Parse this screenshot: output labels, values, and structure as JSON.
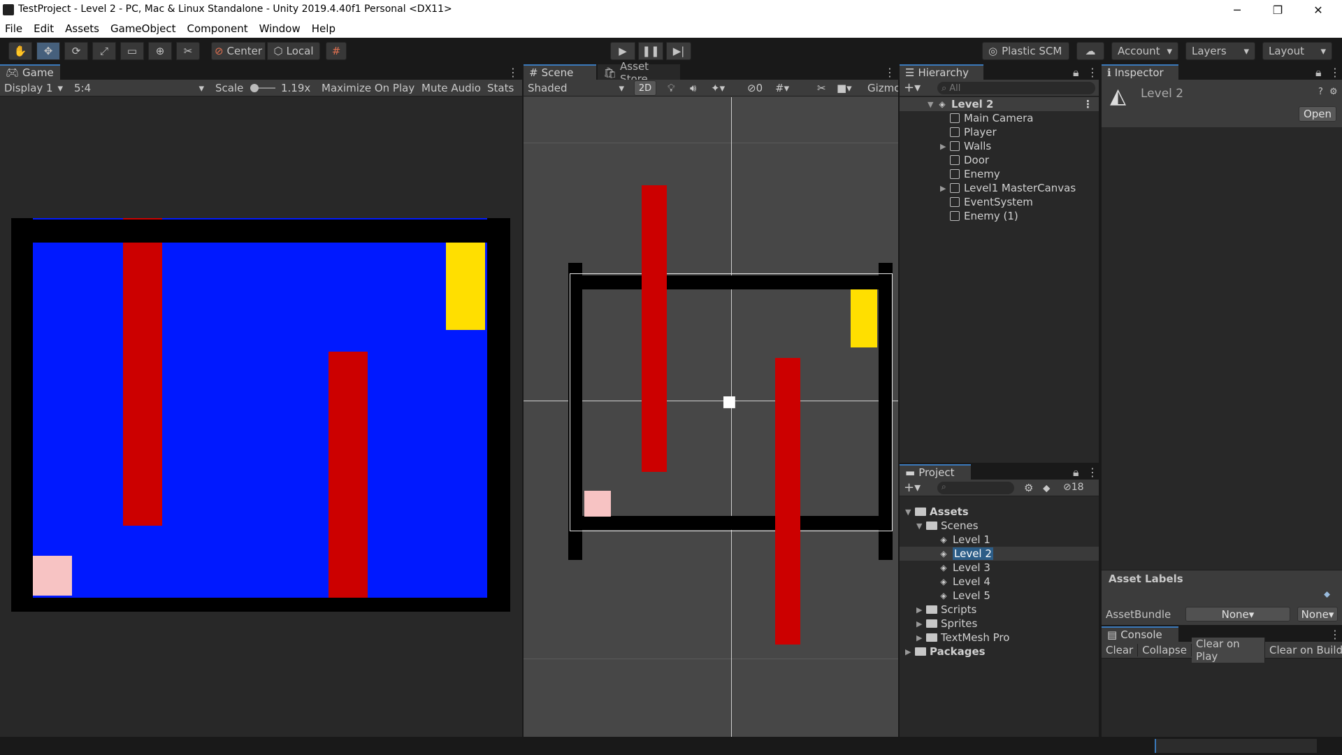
{
  "window": {
    "title": "TestProject - Level 2 - PC, Mac & Linux Standalone - Unity 2019.4.40f1 Personal <DX11>",
    "minimize_glyph": "─",
    "restore_glyph": "❐",
    "close_glyph": "✕"
  },
  "menu": [
    "File",
    "Edit",
    "Assets",
    "GameObject",
    "Component",
    "Window",
    "Help"
  ],
  "toolbar": {
    "pivot_label": "Center",
    "space_label": "Local",
    "plastic_label": "Plastic SCM",
    "account_label": "Account",
    "layers_label": "Layers",
    "layout_label": "Layout"
  },
  "game": {
    "tab_label": "Game",
    "display": "Display 1",
    "aspect": "5:4",
    "scale_label": "Scale",
    "scale_value": "1.19x",
    "maximize": "Maximize On Play",
    "mute": "Mute Audio",
    "stats": "Stats"
  },
  "scene": {
    "tab_label": "Scene",
    "asset_store_label": "Asset Store",
    "shading": "Shaded",
    "mode_2d": "2D",
    "hidden_count": "0",
    "gizmos": "Gizmos"
  },
  "hierarchy": {
    "tab_label": "Hierarchy",
    "search_placeholder": "All",
    "scene_name": "Level 2",
    "items": [
      "Main Camera",
      "Player",
      "Walls",
      "Door",
      "Enemy",
      "Level1 MasterCanvas",
      "EventSystem",
      "Enemy (1)"
    ]
  },
  "inspector": {
    "tab_label": "Inspector",
    "object_name": "Level 2",
    "open_button": "Open",
    "asset_labels": "Asset Labels",
    "asset_bundle_label": "AssetBundle",
    "asset_bundle_value": "None",
    "asset_bundle_variant": "None"
  },
  "project": {
    "tab_label": "Project",
    "hidden_count": "18",
    "assets_label": "Assets",
    "scenes_label": "Scenes",
    "scenes": [
      "Level 1",
      "Level 2",
      "Level 3",
      "Level 4",
      "Level 5"
    ],
    "folders": [
      "Scripts",
      "Sprites",
      "TextMesh Pro"
    ],
    "packages_label": "Packages"
  },
  "console": {
    "tab_label": "Console",
    "clear": "Clear",
    "collapse": "Collapse",
    "clear_on_play": "Clear on Play",
    "clear_on_build": "Clear on Build"
  },
  "colors": {
    "blue": "#0019ff",
    "red": "#cc0000",
    "yellow": "#ffdf00",
    "pink": "#f7c3c3",
    "accent": "#3a79bb"
  }
}
